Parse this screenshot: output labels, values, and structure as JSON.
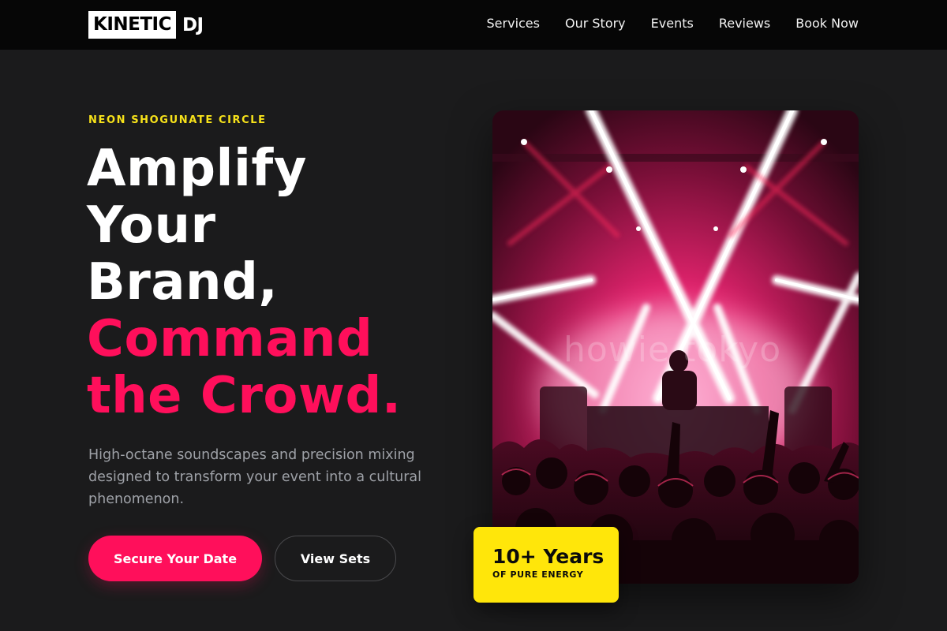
{
  "brand": {
    "logo_box": "KINETIC",
    "logo_text": "DJ"
  },
  "nav": {
    "items": [
      {
        "label": "Services"
      },
      {
        "label": "Our Story"
      },
      {
        "label": "Events"
      },
      {
        "label": "Reviews"
      },
      {
        "label": "Book Now"
      }
    ]
  },
  "hero": {
    "eyebrow": "NEON SHOGUNATE CIRCLE",
    "headline_lines": [
      "Amplify",
      "Your",
      "Brand,"
    ],
    "headline_accent_lines": [
      "Command",
      "the Crowd."
    ],
    "subtext": "High-octane soundscapes and precision mixing designed to transform your event into a cultural phenomenon.",
    "primary_button": "Secure Your Date",
    "secondary_button": "View Sets",
    "image_watermark": "howie tokyo",
    "badge": {
      "headline": "10+ Years",
      "caption": "OF PURE ENERGY"
    }
  },
  "colors": {
    "accent": "#ff0f5b",
    "highlight": "#ffe60a",
    "background": "#1b1b1c",
    "nav_bg": "#060606"
  }
}
